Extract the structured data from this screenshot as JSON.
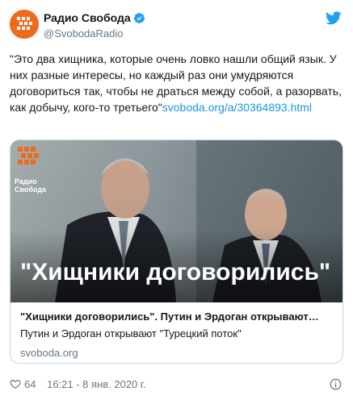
{
  "account": {
    "display_name": "Радио Свобода",
    "handle": "@SvobodaRadio",
    "verified": true,
    "brand_color": "#ee6b1e"
  },
  "tweet": {
    "text": "\"Это два хищника, которые очень ловко нашли общий язык. У них разные интересы, но каждый раз они умудряются договориться так, чтобы не драться между собой, а разорвать, как добычу, кого-то третьего\"",
    "link": "svoboda.org/a/30364893.html"
  },
  "card": {
    "logo_text": "Радио Свобода",
    "image_caption": "\"Хищники договорились\"",
    "title": "\"Хищники договорились\". Путин и Эрдоган открывают…",
    "description": "Путин и Эрдоган открывают \"Турецкий поток\"",
    "domain": "svoboda.org"
  },
  "footer": {
    "likes": "64",
    "timestamp": "16:21 - 8 янв. 2020 г."
  },
  "icons": {
    "twitter_bird": "twitter-bird-icon",
    "verified": "verified-badge-icon",
    "like": "heart-icon",
    "info": "info-icon",
    "brand_accent": "#1b95e0"
  }
}
